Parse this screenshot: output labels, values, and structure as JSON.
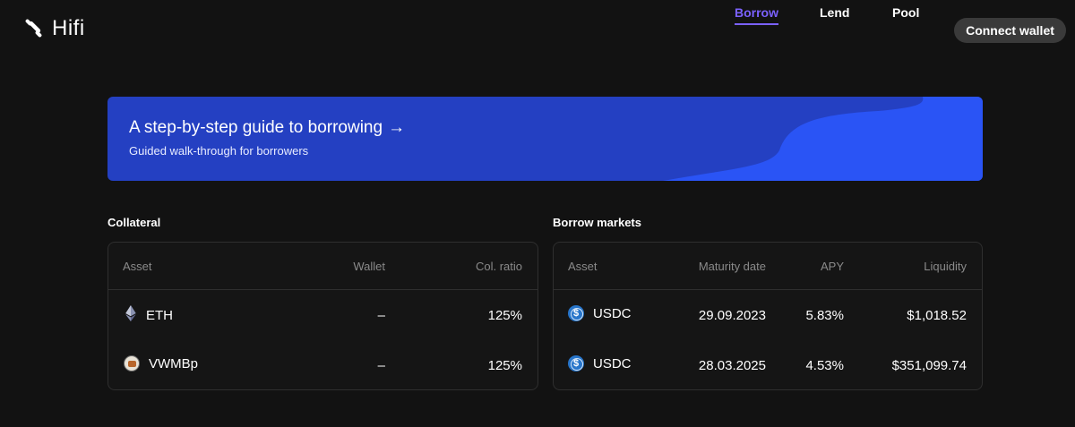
{
  "brand": {
    "name": "Hifi"
  },
  "nav": {
    "items": [
      {
        "label": "Borrow",
        "active": true
      },
      {
        "label": "Lend",
        "active": false
      },
      {
        "label": "Pool",
        "active": false
      }
    ],
    "connect_label": "Connect wallet"
  },
  "banner": {
    "title": "A step-by-step guide to borrowing",
    "arrow": "→",
    "subtitle": "Guided walk-through for borrowers"
  },
  "collateral": {
    "title": "Collateral",
    "columns": [
      "Asset",
      "Wallet",
      "Col. ratio"
    ],
    "rows": [
      {
        "asset": "ETH",
        "icon": "eth-icon",
        "wallet": "–",
        "ratio": "125%"
      },
      {
        "asset": "VWMBp",
        "icon": "vwmbp-icon",
        "wallet": "–",
        "ratio": "125%"
      }
    ]
  },
  "borrow_markets": {
    "title": "Borrow markets",
    "columns": [
      "Asset",
      "Maturity date",
      "APY",
      "Liquidity"
    ],
    "rows": [
      {
        "asset": "USDC",
        "icon": "usdc-icon",
        "maturity": "29.09.2023",
        "apy": "5.83%",
        "liquidity": "$1,018.52"
      },
      {
        "asset": "USDC",
        "icon": "usdc-icon",
        "maturity": "28.03.2025",
        "apy": "4.53%",
        "liquidity": "$351,099.74"
      }
    ]
  },
  "colors": {
    "background": "#121212",
    "accent": "#7b61ff",
    "banner": "#2440c2",
    "banner_wave": "#2a54f5",
    "card_border": "#2f2f2f",
    "muted_text": "#8a8a8a"
  }
}
